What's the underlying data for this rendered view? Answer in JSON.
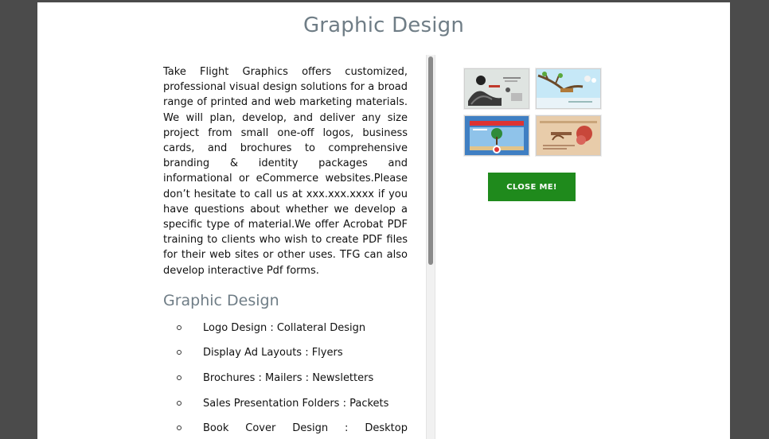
{
  "modal": {
    "title": "Graphic Design",
    "description": "Take Flight Graphics offers customized, professional visual design solutions for a broad range of printed and web marketing materials. We will plan, develop, and deliver any size project from small one-off logos, business cards, and brochures to comprehensive branding & identity packages and informational or eCommerce websites.Please don’t hesitate to call us at xxx.xxx.xxxx if you have questions about whether we develop a specific type of material.We offer Acrobat PDF training to clients who wish to create PDF files for their web sites or other uses. TFG can also develop interactive Pdf forms.",
    "section_heading": "Graphic Design",
    "services": [
      "Logo Design : Collateral Design",
      "Display Ad Layouts : Flyers",
      "Brochures : Mailers : Newsletters",
      "Sales Presentation Folders : Packets"
    ],
    "services_partial": [
      "Book",
      "Cover",
      "Design",
      ":",
      "Desktop"
    ],
    "close_label": "CLOSE ME!"
  },
  "colors": {
    "overlay": "#4b4b4b",
    "heading": "#6f7d86",
    "button": "#1f8a1c"
  }
}
